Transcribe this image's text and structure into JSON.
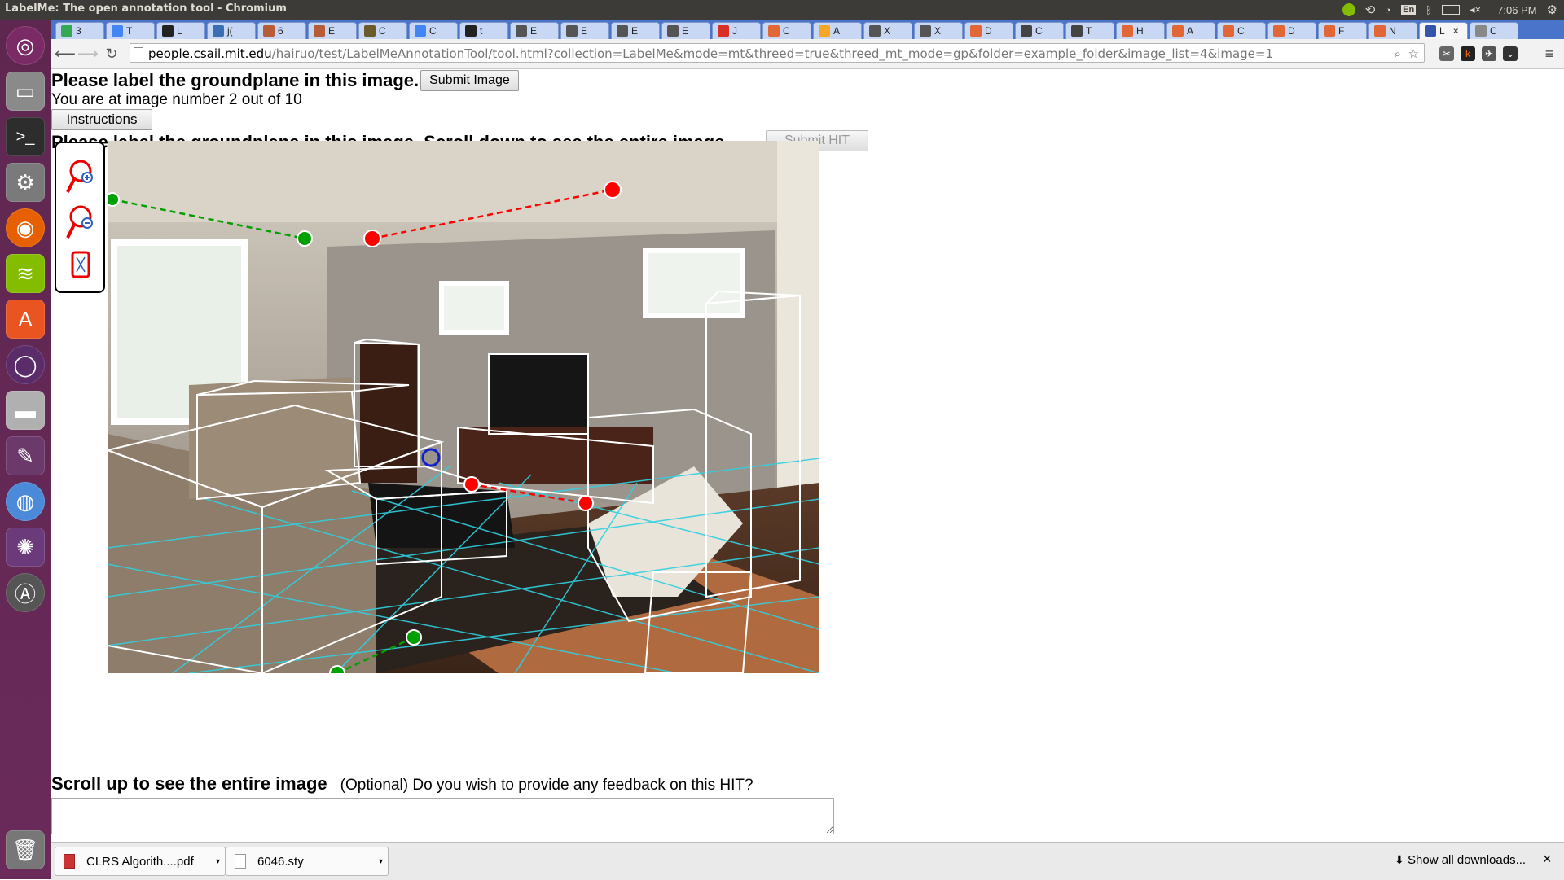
{
  "window": {
    "title": "LabelMe: The open annotation tool - Chromium",
    "clock": "7:06 PM",
    "keyboard_layout": "En"
  },
  "launcher": {
    "items": [
      "ubuntu-dash-icon",
      "files-icon",
      "terminal-icon",
      "system-settings-icon",
      "firefox-icon",
      "spotify-icon",
      "software-center-icon",
      "unity-tweak-icon",
      "disk-drive-icon",
      "text-editor-icon",
      "chromium-icon",
      "shotwell-icon",
      "software-updater-icon",
      "trash-icon"
    ]
  },
  "tabs": [
    {
      "label": "3",
      "icon": "google-drive-icon",
      "color": "#34a853"
    },
    {
      "label": "T",
      "icon": "docs-icon",
      "color": "#4285f4"
    },
    {
      "label": "L",
      "icon": "github-icon",
      "color": "#222222"
    },
    {
      "label": "j(",
      "icon": "js-icon",
      "color": "#3a6fb5"
    },
    {
      "label": "6",
      "icon": "bookmark-icon",
      "color": "#b85c38"
    },
    {
      "label": "E",
      "icon": "bookmark-icon",
      "color": "#b85c38"
    },
    {
      "label": "C",
      "icon": "lab-icon",
      "color": "#6b5a2a"
    },
    {
      "label": "C",
      "icon": "docs-icon",
      "color": "#4285f4"
    },
    {
      "label": "t",
      "icon": "github-icon",
      "color": "#222222"
    },
    {
      "label": "E",
      "icon": "wiki-icon",
      "color": "#555555"
    },
    {
      "label": "E",
      "icon": "wiki-icon",
      "color": "#555555"
    },
    {
      "label": "E",
      "icon": "wiki-icon",
      "color": "#555555"
    },
    {
      "label": "E",
      "icon": "wiki-icon",
      "color": "#555555"
    },
    {
      "label": "J",
      "icon": "gmail-icon",
      "color": "#d93025"
    },
    {
      "label": "C",
      "icon": "matlab-icon",
      "color": "#e16737"
    },
    {
      "label": "A",
      "icon": "circle-icon",
      "color": "#f5a623"
    },
    {
      "label": "X",
      "icon": "w3-icon",
      "color": "#555555"
    },
    {
      "label": "X",
      "icon": "w3-icon",
      "color": "#555555"
    },
    {
      "label": "D",
      "icon": "matlab-icon",
      "color": "#e16737"
    },
    {
      "label": "C",
      "icon": "wikipedia-icon",
      "color": "#444444"
    },
    {
      "label": "T",
      "icon": "wikipedia-icon",
      "color": "#444444"
    },
    {
      "label": "H",
      "icon": "matlab-icon",
      "color": "#e16737"
    },
    {
      "label": "A",
      "icon": "matlab-icon",
      "color": "#e16737"
    },
    {
      "label": "C",
      "icon": "matlab-icon",
      "color": "#e16737"
    },
    {
      "label": "D",
      "icon": "matlab-icon",
      "color": "#e16737"
    },
    {
      "label": "F",
      "icon": "matlab-icon",
      "color": "#e16737"
    },
    {
      "label": "N",
      "icon": "matlab-icon",
      "color": "#e16737"
    },
    {
      "label": "L",
      "icon": "labelme-icon",
      "color": "#3355aa",
      "active": true
    },
    {
      "label": "C",
      "icon": "page-icon",
      "color": "#888888"
    }
  ],
  "address_bar": {
    "host": "people.csail.mit.edu",
    "path": "/hairuo/test/LabelMeAnnotationTool/tool.html?collection=LabelMe&mode=mt&threed=true&threed_mt_mode=gp&folder=example_folder&image_list=4&image=1"
  },
  "page": {
    "heading": "Please label the groundplane in this image.",
    "submit_image_label": "Submit Image",
    "progress_text": "You are at image number 2 out of 10",
    "instructions_label": "Instructions",
    "heading_hidden": "Please label the groundplane in this image. Scroll down to see the entire image.",
    "submit_hit_label": "Submit HIT",
    "scroll_up_text": "Scroll up to see the entire image",
    "feedback_prompt": "(Optional) Do you wish to provide any feedback on this HIT?",
    "feedback_value": ""
  },
  "annotation_tools": [
    "zoom-in-icon",
    "zoom-out-icon",
    "fit-image-icon"
  ],
  "downloads": {
    "items": [
      {
        "name": "CLRS Algorith....pdf",
        "icon": "pdf-icon"
      },
      {
        "name": "6046.sty",
        "icon": "file-icon"
      }
    ],
    "show_all_label": "Show all downloads...",
    "close_label": "×"
  },
  "colors": {
    "launcher": "#5e2750",
    "tabstrip": "#4a74c9",
    "ground_line_red": "#ff0000",
    "ground_line_green": "#00a000",
    "grid_cyan": "#30d0e0"
  }
}
